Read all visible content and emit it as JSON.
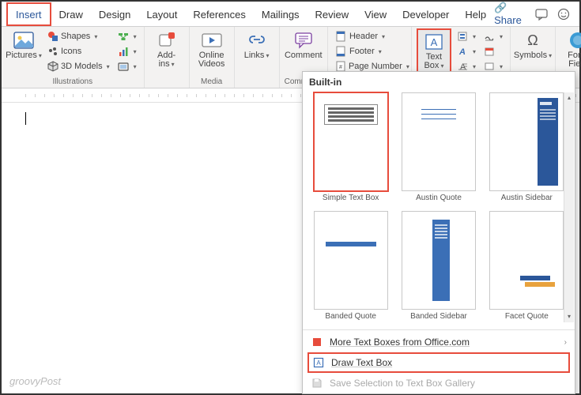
{
  "tabs": {
    "insert": "Insert",
    "draw": "Draw",
    "design": "Design",
    "layout": "Layout",
    "references": "References",
    "mailings": "Mailings",
    "review": "Review",
    "view": "View",
    "developer": "Developer",
    "help": "Help"
  },
  "share": "Share",
  "ribbon": {
    "pictures": "Pictures",
    "shapes": "Shapes",
    "icons": "Icons",
    "models3d": "3D Models",
    "illustrations_label": "Illustrations",
    "addins": "Add-\nins",
    "online_videos": "Online\nVideos",
    "media_label": "Media",
    "links": "Links",
    "comment": "Comment",
    "comments_label": "Comments",
    "header": "Header",
    "footer": "Footer",
    "page_number": "Page Number",
    "textbox": "Text\nBox",
    "symbols": "Symbols",
    "form_field": "Form\nField"
  },
  "dropdown": {
    "builtin": "Built-in",
    "thumbs": {
      "simple": "Simple Text Box",
      "austin_quote": "Austin Quote",
      "austin_sidebar": "Austin Sidebar",
      "banded_quote": "Banded Quote",
      "banded_sidebar": "Banded Sidebar",
      "facet_quote": "Facet Quote"
    },
    "more": "More Text Boxes from Office.com",
    "draw": "Draw Text Box",
    "save_sel": "Save Selection to Text Box Gallery"
  },
  "watermark": "groovyPost"
}
